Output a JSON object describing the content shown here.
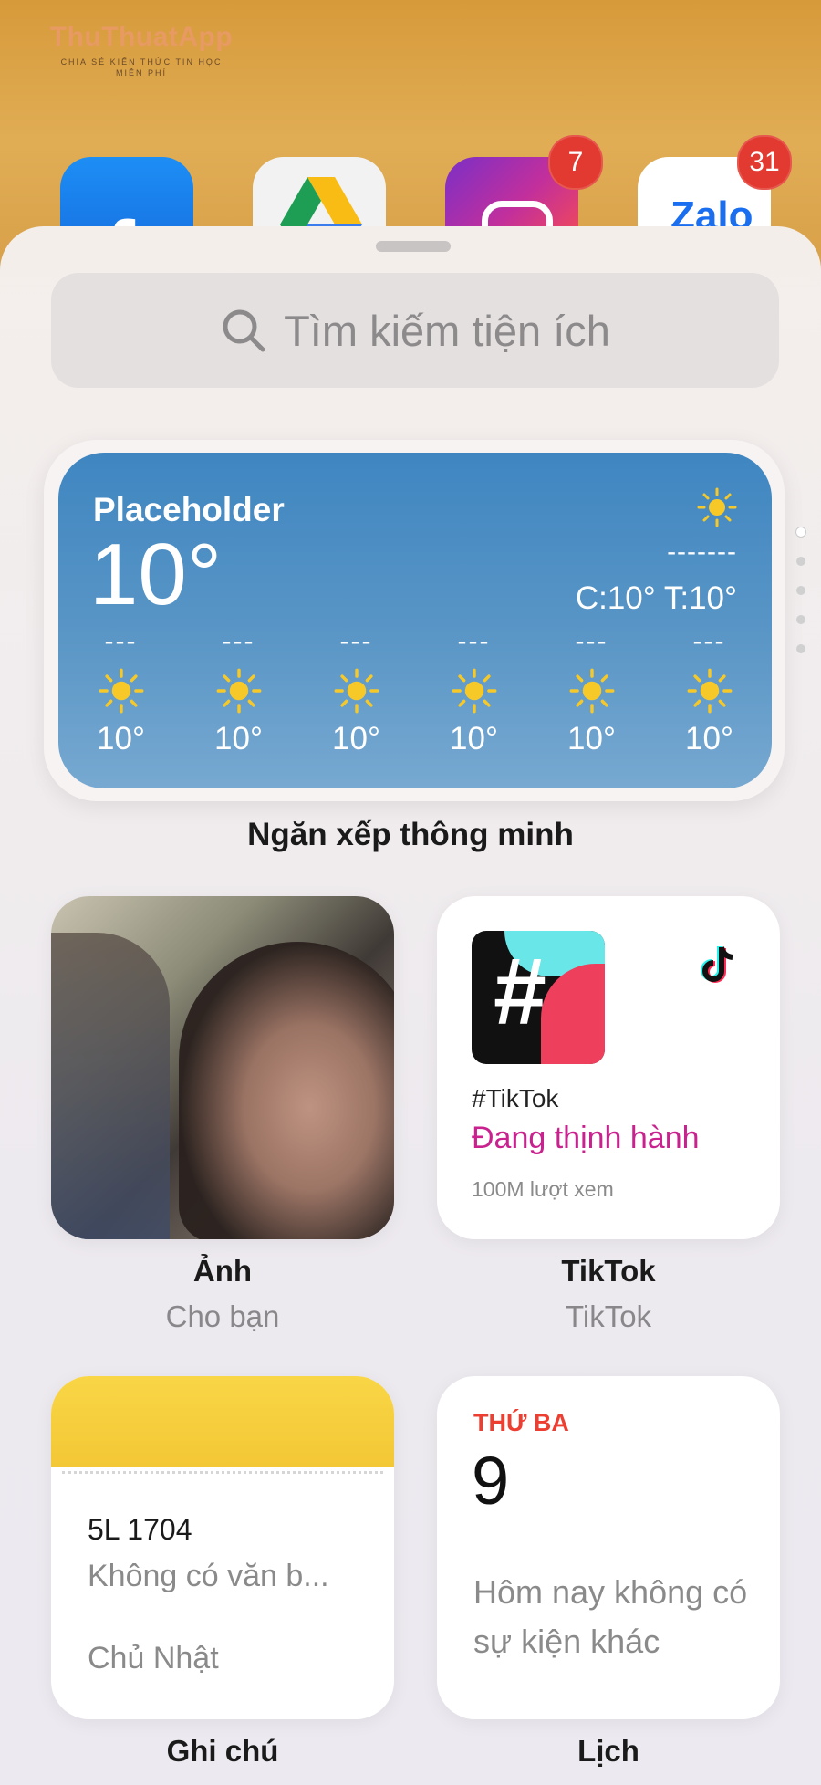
{
  "watermark": {
    "title": "ThuThuatApp",
    "subtitle": "CHIA SẺ KIẾN THỨC TIN HỌC MIỄN PHÍ"
  },
  "home_apps": [
    {
      "name": "Facebook",
      "glyph": "f"
    },
    {
      "name": "Google Drive"
    },
    {
      "name": "Instagram",
      "badge": "7"
    },
    {
      "name": "Zalo",
      "glyph": "Zalo",
      "badge": "31"
    }
  ],
  "search": {
    "placeholder": "Tìm kiếm tiện ích"
  },
  "weather": {
    "location": "Placeholder",
    "temp": "10°",
    "condition": "-------",
    "hi_lo": "C:10° T:10°",
    "hours": [
      {
        "label": "---",
        "temp": "10°"
      },
      {
        "label": "---",
        "temp": "10°"
      },
      {
        "label": "---",
        "temp": "10°"
      },
      {
        "label": "---",
        "temp": "10°"
      },
      {
        "label": "---",
        "temp": "10°"
      },
      {
        "label": "---",
        "temp": "10°"
      }
    ]
  },
  "smart_stack": {
    "caption": "Ngăn xếp thông minh"
  },
  "photos": {
    "title": "Ảnh",
    "subtitle": "Cho bạn"
  },
  "tiktok": {
    "tag": "#TikTok",
    "trend": "Đang thịnh hành",
    "views": "100M lượt xem",
    "title": "TikTok",
    "subtitle": "TikTok"
  },
  "notes": {
    "note_title": "5L 1704",
    "preview": "Không có văn b...",
    "date": "Chủ Nhật",
    "caption": "Ghi chú"
  },
  "calendar": {
    "weekday": "THỨ BA",
    "day": "9",
    "event": "Hôm nay không có sự kiện khác",
    "caption": "Lịch"
  },
  "colors": {
    "weather_bg": "#4a8bc3",
    "sun": "#f7c928",
    "badge": "#e23a30",
    "trend": "#c9218e",
    "calendar_red": "#ec3f32",
    "notes_yellow": "#f6cf3e"
  }
}
